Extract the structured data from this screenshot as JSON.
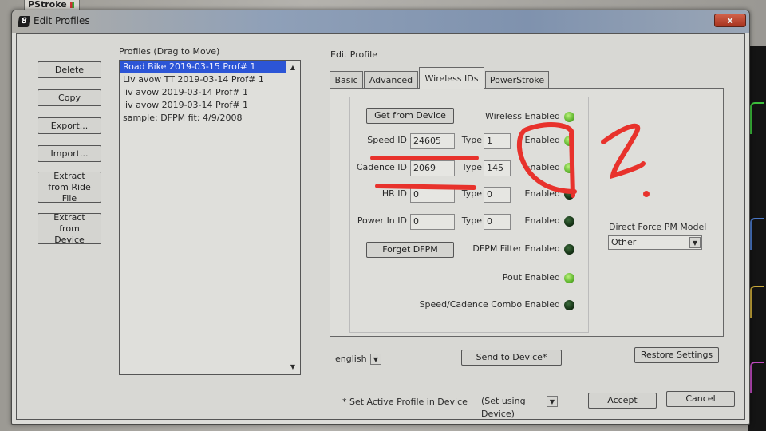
{
  "background": {
    "tab_label": "PStroke"
  },
  "dialog": {
    "title": "Edit Profiles",
    "close_label": "x",
    "left_buttons": [
      {
        "label": "Delete"
      },
      {
        "label": "Copy"
      },
      {
        "label": "Export..."
      },
      {
        "label": "Import..."
      },
      {
        "label": "Extract from Ride File"
      },
      {
        "label": "Extract from Device"
      }
    ],
    "profiles": {
      "label": "Profiles (Drag to Move)",
      "items": [
        {
          "name": "Road Bike 2019-03-15 Prof# 1",
          "selected": true
        },
        {
          "name": "Liv avow TT 2019-03-14 Prof# 1",
          "selected": false
        },
        {
          "name": "liv avow 2019-03-14 Prof# 1",
          "selected": false
        },
        {
          "name": "liv avow 2019-03-14 Prof# 1",
          "selected": false
        },
        {
          "name": "sample: DFPM fit: 4/9/2008",
          "selected": false
        }
      ]
    },
    "edit_profile": {
      "label": "Edit Profile",
      "tabs": [
        {
          "label": "Basic",
          "active": false
        },
        {
          "label": "Advanced",
          "active": false
        },
        {
          "label": "Wireless IDs",
          "active": true
        },
        {
          "label": "PowerStroke",
          "active": false
        }
      ],
      "get_from_device_label": "Get from Device",
      "forget_dfpm_label": "Forget DFPM",
      "type_label": "Type",
      "enabled_label": "Enabled",
      "ids": [
        {
          "label": "Speed ID",
          "id": "24605",
          "type": "1",
          "enabled": true
        },
        {
          "label": "Cadence ID",
          "id": "2069",
          "type": "145",
          "enabled": true
        },
        {
          "label": "HR ID",
          "id": "0",
          "type": "0",
          "enabled": false
        },
        {
          "label": "Power In ID",
          "id": "0",
          "type": "0",
          "enabled": false
        }
      ],
      "status": {
        "wireless_enabled": {
          "label": "Wireless Enabled",
          "on": true
        },
        "dfpm_filter_enabled": {
          "label": "DFPM Filter Enabled",
          "on": false
        },
        "pout_enabled": {
          "label": "Pout Enabled",
          "on": true
        },
        "speed_cadence_combo_enabled": {
          "label": "Speed/Cadence Combo Enabled",
          "on": false
        }
      },
      "direct_force_pm_model": {
        "label": "Direct Force PM Model",
        "value": "Other"
      }
    },
    "language": {
      "value": "english"
    },
    "send_to_device_label": "Send to Device*",
    "restore_settings_label": "Restore Settings",
    "active_profile": {
      "label": "* Set Active Profile in Device",
      "value": "(Set using Device)"
    },
    "accept_label": "Accept",
    "cancel_label": "Cancel"
  },
  "colors": {
    "selection": "#2c55d6",
    "led_on": "#5fb52e",
    "led_off": "#173417",
    "annotation": "#e8322c",
    "close_button": "#b8402a"
  },
  "annotations": {
    "handwritten_mark": "?"
  }
}
